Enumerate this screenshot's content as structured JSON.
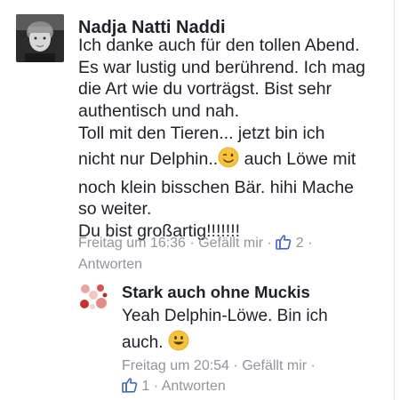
{
  "comments": [
    {
      "author": "Nadja Natti Naddi",
      "lines": [
        "Ich danke auch für den tollen Abend.",
        "Es war lustig und berührend. Ich mag",
        "die Art wie du vorträgst. Bist sehr",
        "authentisch und nah.",
        "Toll mit den Tieren... jetzt bin ich",
        "nicht nur Delphin..",
        "auch Löwe mit",
        "noch klein bisschen Bär. hihi Mache",
        "so weiter.",
        "Du bist großartig!!!!!!!"
      ],
      "emoji": "wink-emoji",
      "time": "Freitag um 16:36",
      "sep": "·",
      "like_label": "Gefällt mir",
      "like_count": "2",
      "reply_label": "Antworten"
    },
    {
      "author": "Stark auch ohne Muckis",
      "lines": [
        "Yeah Delphin-Löwe. Bin ich",
        "auch."
      ],
      "emoji": "smile-emoji",
      "time": "Freitag um 20:54",
      "sep": "·",
      "like_label": "Gefällt mir",
      "like_count": "1",
      "reply_label": "Antworten"
    }
  ],
  "colors": {
    "text": "#1d2129",
    "meta": "#90949c",
    "like_blue": "#4267b2",
    "emoji_yellow": "#f7c23c"
  }
}
